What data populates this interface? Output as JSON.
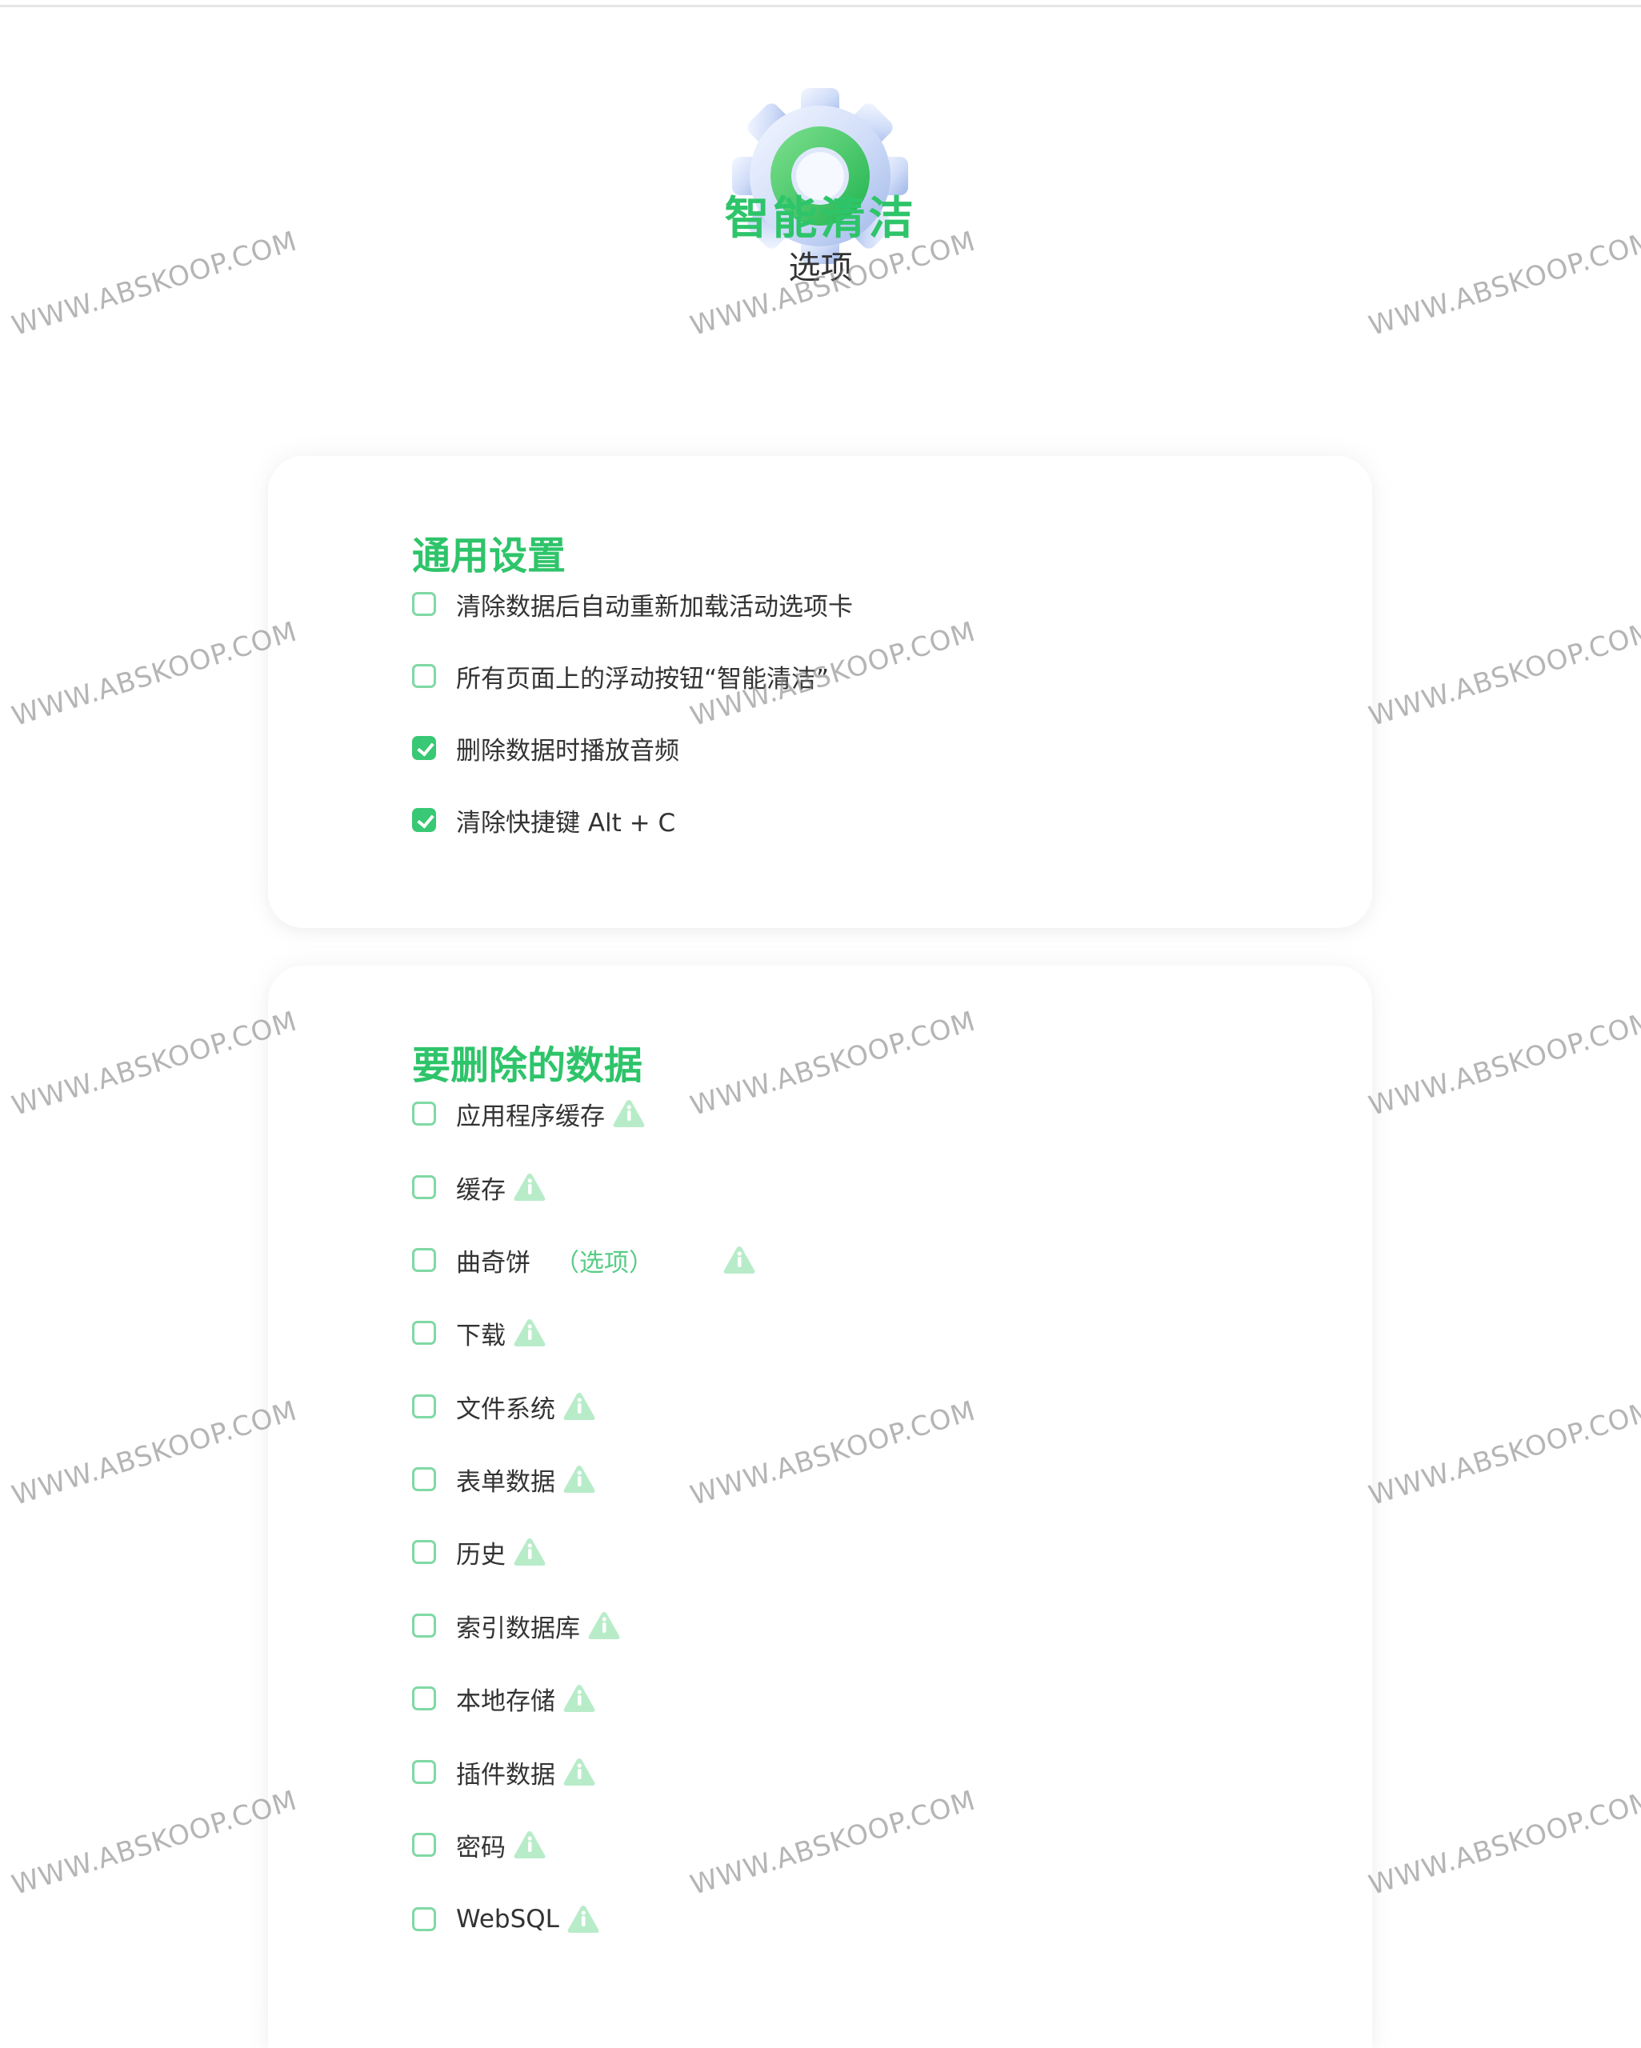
{
  "app": {
    "title": "智能清洁",
    "subtitle": "选项"
  },
  "general": {
    "title": "通用设置",
    "options": [
      {
        "label": "清除数据后自动重新加载活动选项卡",
        "checked": false
      },
      {
        "label": "所有页面上的浮动按钮“智能清洁”",
        "checked": false
      },
      {
        "label": "删除数据时播放音频",
        "checked": true
      },
      {
        "label": "清除快捷键 Alt + C",
        "checked": true
      }
    ]
  },
  "data": {
    "title": "要删除的数据",
    "options": [
      {
        "label": "应用程序缓存",
        "checked": false,
        "icon": "warning-icon"
      },
      {
        "label": "缓存",
        "checked": false,
        "icon": "warning-icon"
      },
      {
        "label": "曲奇饼",
        "suffix": "（选项）",
        "checked": false,
        "icon": "warning-icon"
      },
      {
        "label": "下载",
        "checked": false,
        "icon": "warning-icon"
      },
      {
        "label": "文件系统",
        "checked": false,
        "icon": "warning-icon"
      },
      {
        "label": "表单数据",
        "checked": false,
        "icon": "warning-icon"
      },
      {
        "label": "历史",
        "checked": false,
        "icon": "warning-icon"
      },
      {
        "label": "索引数据库",
        "checked": false,
        "icon": "warning-icon"
      },
      {
        "label": "本地存储",
        "checked": false,
        "icon": "warning-icon"
      },
      {
        "label": "插件数据",
        "checked": false,
        "icon": "warning-icon"
      },
      {
        "label": "密码",
        "checked": false,
        "icon": "warning-icon"
      },
      {
        "label": "WebSQL",
        "checked": false,
        "icon": "warning-icon"
      }
    ]
  },
  "watermark": {
    "text": "WWW.ABSKOOP.COM"
  },
  "colors": {
    "accent": "#2ec46a",
    "checkbox_border": "#7fd9a3",
    "checkbox_checked": "#39c874",
    "warning_icon": "#b8ecc9"
  }
}
